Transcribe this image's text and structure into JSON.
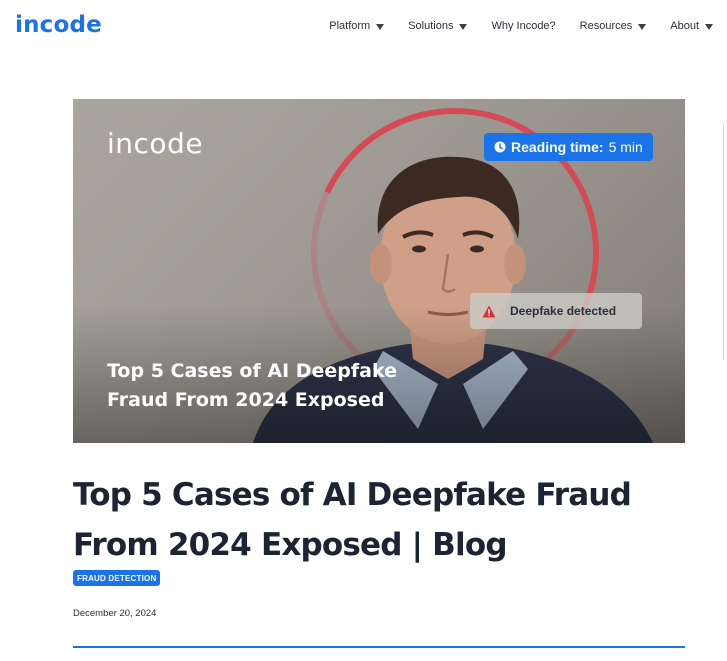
{
  "header": {
    "logo": "incode",
    "nav": [
      {
        "label": "Platform",
        "has_caret": true
      },
      {
        "label": "Solutions",
        "has_caret": true
      },
      {
        "label": "Why Incode?",
        "has_caret": false
      },
      {
        "label": "Resources",
        "has_caret": true
      },
      {
        "label": "About",
        "has_caret": true
      }
    ]
  },
  "hero": {
    "logo": "incode",
    "reading_label": "Reading time:",
    "reading_value": "5 min",
    "deepfake_text": "Deepfake detected",
    "title": "Top 5 Cases of AI Deepfake Fraud From 2024 Exposed",
    "icons": {
      "reading": "clock-icon",
      "deepfake": "warning-icon"
    }
  },
  "article": {
    "title": "Top 5 Cases of AI Deepfake Fraud From 2024 Exposed | Blog",
    "tag": "FRAUD DETECTION",
    "date": "December 20, 2024"
  },
  "colors": {
    "brand": "#1a73e8",
    "text": "#1c2333",
    "alert_ring": "#d54b55"
  }
}
